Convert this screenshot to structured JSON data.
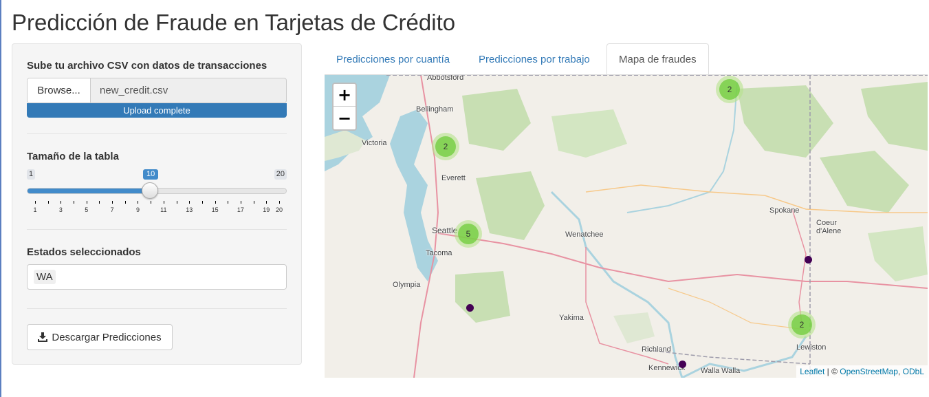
{
  "page_title": "Predicción de Fraude en Tarjetas de Crédito",
  "sidebar": {
    "upload_label": "Sube tu archivo CSV con datos de transacciones",
    "browse_label": "Browse...",
    "file_name": "new_credit.csv",
    "upload_status": "Upload complete",
    "slider_label": "Tamaño de la tabla",
    "slider_min": "1",
    "slider_max": "20",
    "slider_value": "10",
    "slider_ticks": [
      "1",
      "3",
      "5",
      "7",
      "9",
      "11",
      "13",
      "15",
      "17",
      "19",
      "20"
    ],
    "states_label": "Estados seleccionados",
    "selected_state": "WA",
    "download_label": "Descargar Predicciones",
    "download_icon": "download-icon"
  },
  "tabs": [
    {
      "label": "Predicciones por cuantía"
    },
    {
      "label": "Predicciones por trabajo"
    },
    {
      "label": "Mapa de fraudes"
    }
  ],
  "map": {
    "zoom_in": "+",
    "zoom_out": "−",
    "attribution_leaflet": "Leaflet",
    "attribution_sep": " | © ",
    "attribution_osm": "OpenStreetMap",
    "attribution_comma": ", ",
    "attribution_odbl": "ODbL",
    "clusters": [
      "2",
      "2",
      "5",
      "2"
    ],
    "cities": [
      "Abbotsford",
      "Bellingham",
      "Victoria",
      "Everett",
      "Seattle",
      "Tacoma",
      "Olympia",
      "Wenatchee",
      "Spokane",
      "Coeur d'Alene",
      "Yakima",
      "Richland",
      "Kennewick",
      "Walla Walla",
      "Lewiston"
    ]
  },
  "colors": {
    "accent": "#337ab7",
    "marker": "#440154",
    "cluster": "#6ecc39"
  }
}
